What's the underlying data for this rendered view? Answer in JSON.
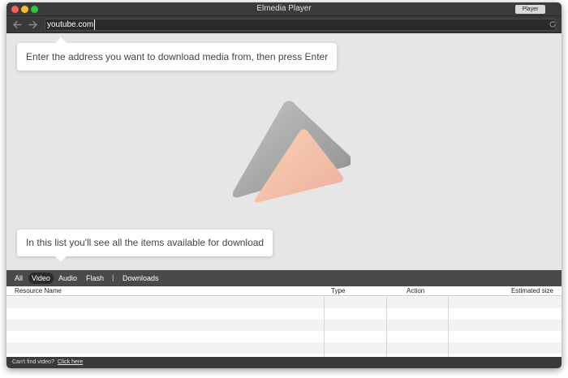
{
  "window": {
    "title": "Elmedia Player",
    "player_button": "Player"
  },
  "address_bar": {
    "url": "youtube.com"
  },
  "tooltips": {
    "top": "Enter the address you want to download media from, then press Enter",
    "bottom": "In this list you'll see all the items available for download"
  },
  "filters": {
    "all": "All",
    "video": "Video",
    "audio": "Audio",
    "flash": "Flash",
    "separator": "|",
    "downloads": "Downloads",
    "active": "Video"
  },
  "table": {
    "columns": [
      "Resource Name",
      "Type",
      "Action",
      "Estimated size"
    ],
    "rows": []
  },
  "status_bar": {
    "text": "Can't find video?",
    "link": "Click here"
  },
  "icons": {
    "back": "chevron-left-icon",
    "forward": "chevron-right-icon",
    "reload": "reload-icon",
    "logo": "elmedia-logo"
  },
  "colors": {
    "close": "#fc5f57",
    "minimize": "#fdbc2e",
    "maximize": "#28c840",
    "logo_gray": "#9b9b9b",
    "logo_peach": "#f1b79f"
  }
}
